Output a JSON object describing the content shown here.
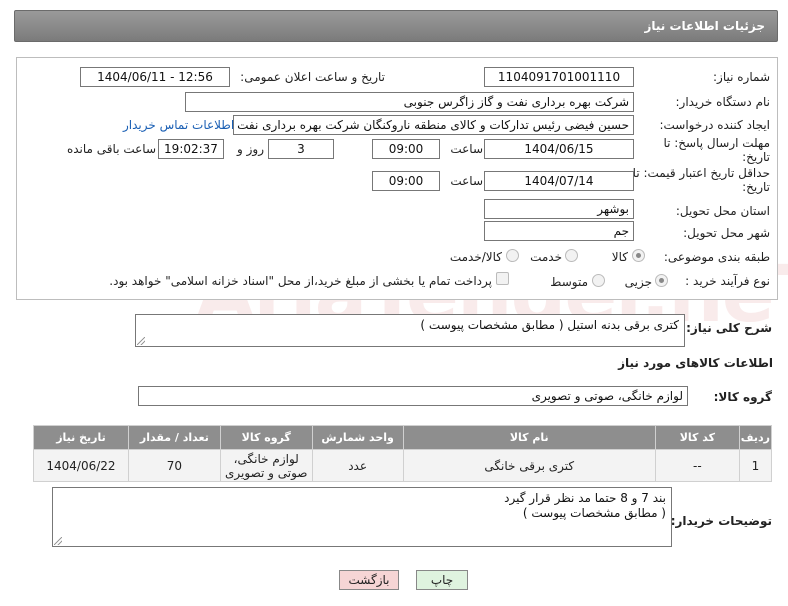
{
  "header": {
    "title": "جزئیات اطلاعات نیاز"
  },
  "form": {
    "need_number_label": "شماره نیاز:",
    "need_number": "1104091701001110",
    "announce_label": "تاریخ و ساعت اعلان عمومی:",
    "announce_value": "1404/06/11 - 12:56",
    "buyer_org_label": "نام دستگاه خریدار:",
    "buyer_org": "شرکت بهره برداری نفت و گاز زاگرس جنوبی",
    "creator_label": "ایجاد کننده درخواست:",
    "creator": "حسین فیضی رئیس تدارکات و کالای منطقه ناروکنگان شرکت بهره برداری نفت و",
    "contact_link": "اطلاعات تماس خریدار",
    "deadline_label": "مهلت ارسال پاسخ: تا تاریخ:",
    "deadline_date": "1404/06/15",
    "time_label": "ساعت",
    "deadline_time": "09:00",
    "days_value": "3",
    "days_label": "روز و",
    "remaining_time": "19:02:37",
    "remaining_label": "ساعت باقی مانده",
    "validity_label": "حداقل تاریخ اعتبار قیمت: تا تاریخ:",
    "validity_date": "1404/07/14",
    "validity_time": "09:00",
    "province_label": "استان محل تحویل:",
    "province": "بوشهر",
    "city_label": "شهر محل تحویل:",
    "city": "جم",
    "category_label": "طبقه بندی موضوعی:",
    "category_options": [
      "کالا",
      "خدمت",
      "کالا/خدمت"
    ],
    "process_label": "نوع فرآیند خرید :",
    "process_options": [
      "جزیی",
      "متوسط"
    ],
    "payment_note": "پرداخت تمام یا بخشی از مبلغ خرید،از محل \"اسناد خزانه اسلامی\" خواهد بود."
  },
  "summary": {
    "label": "شرح کلی نیاز:",
    "value": "کتری برقی بدنه استیل ( مطابق مشخصات پیوست )"
  },
  "goods_section": {
    "title": "اطلاعات کالاهای مورد نیاز",
    "group_label": "گروه کالا:",
    "group_value": "لوازم خانگی، صوتی و تصویری"
  },
  "table": {
    "headers": [
      "ردیف",
      "کد کالا",
      "نام کالا",
      "واحد شمارش",
      "گروه کالا",
      "تعداد / مقدار",
      "تاریخ نیاز"
    ],
    "rows": [
      {
        "row": "1",
        "code": "--",
        "name": "کتری برقی خانگی",
        "unit": "عدد",
        "group": "لوازم خانگی، صوتی و تصویری",
        "qty": "70",
        "date": "1404/06/22"
      }
    ]
  },
  "buyer_notes": {
    "label": "توضیحات خریدار:",
    "line1": "بند  7   و 8  حتما مد نظر قرار گیرد",
    "line2": "( مطابق مشخصات پیوست )"
  },
  "buttons": {
    "print": "چاپ",
    "back": "بازگشت"
  },
  "watermark": "AriaTender.neT",
  "colors": {
    "header_bg": "#8a8a8a",
    "link": "#1a5fb4",
    "back_button": "#f6d5d5",
    "print_button": "#dff3df"
  }
}
